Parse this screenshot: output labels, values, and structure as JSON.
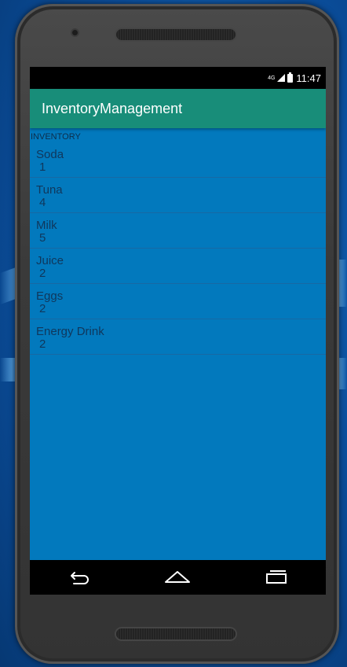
{
  "status_bar": {
    "network": "4G",
    "time": "11:47"
  },
  "app_bar": {
    "title": "InventoryManagement"
  },
  "section_label": "INVENTORY",
  "inventory": [
    {
      "name": "Soda",
      "quantity": "1"
    },
    {
      "name": "Tuna",
      "quantity": "4"
    },
    {
      "name": "Milk",
      "quantity": "5"
    },
    {
      "name": "Juice",
      "quantity": "2"
    },
    {
      "name": "Eggs",
      "quantity": "2"
    },
    {
      "name": "Energy Drink",
      "quantity": "2"
    }
  ],
  "nav_bar": {
    "icons": [
      "back-icon",
      "home-icon",
      "recents-icon"
    ]
  },
  "colors": {
    "app_bar": "#188d79",
    "screen_bg": "#0279bd",
    "item_text": "#10375c"
  }
}
